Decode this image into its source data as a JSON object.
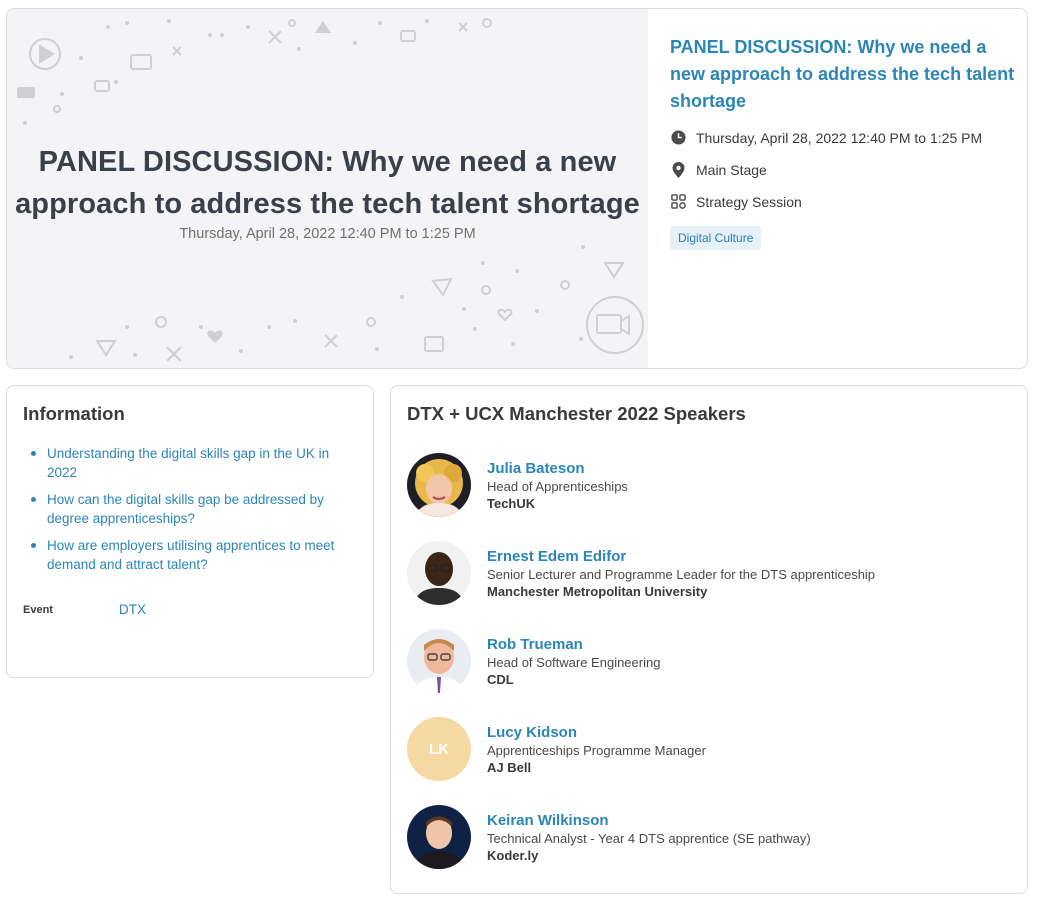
{
  "session": {
    "banner_title_line1": "PANEL DISCUSSION: Why we need a new",
    "banner_title_line2": "approach to address the tech talent shortage",
    "banner_date": "Thursday, April 28, 2022 12:40 PM to 1:25 PM",
    "title": "PANEL DISCUSSION: Why we need a new approach to address the tech talent shortage",
    "datetime": "Thursday, April 28, 2022 12:40 PM to 1:25 PM",
    "location": "Main Stage",
    "session_type": "Strategy Session",
    "tag": "Digital Culture"
  },
  "information": {
    "title": "Information",
    "items": [
      "Understanding the digital skills gap in the UK in 2022",
      "How can the digital skills gap be addressed by degree apprenticeships?",
      "How are employers utilising apprentices to meet demand and attract talent?"
    ],
    "event_label": "Event",
    "event_value": "DTX"
  },
  "speakers": {
    "title": "DTX + UCX Manchester 2022 Speakers",
    "items": [
      {
        "name": "Julia Bateson",
        "role": "Head of Apprenticeships",
        "org": "TechUK"
      },
      {
        "name": "Ernest Edem Edifor",
        "role": "Senior Lecturer and Programme Leader for the DTS apprenticeship",
        "org": "Manchester Metropolitan University"
      },
      {
        "name": "Rob Trueman",
        "role": "Head of Software Engineering",
        "org": "CDL"
      },
      {
        "name": "Lucy Kidson",
        "role": "Apprenticeships Programme Manager",
        "org": "AJ Bell",
        "initials": "LK"
      },
      {
        "name": "Keiran Wilkinson",
        "role": "Technical Analyst - Year 4 DTS apprentice (SE pathway)",
        "org": "Koder.ly"
      }
    ]
  },
  "colors": {
    "accent": "#2b86b8",
    "tag_bg": "#e6f0f7",
    "initials_bg": "#f5d9a2"
  }
}
